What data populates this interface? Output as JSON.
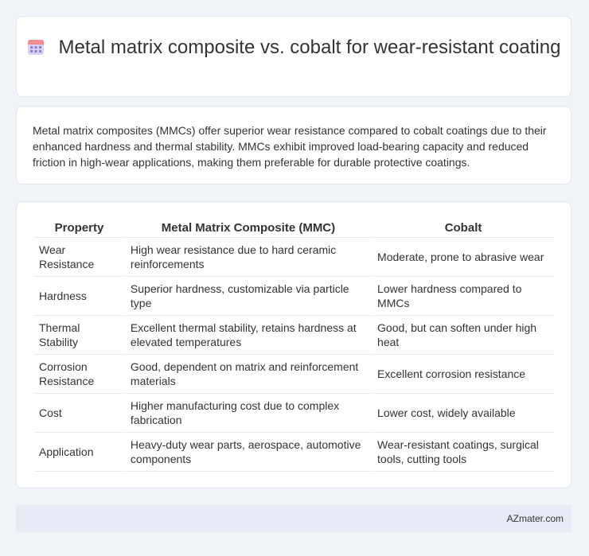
{
  "header": {
    "title": "Metal matrix composite vs. cobalt for wear-resistant coating",
    "icon": "calendar-icon"
  },
  "summary": {
    "text": "Metal matrix composites (MMCs) offer superior wear resistance compared to cobalt coatings due to their enhanced hardness and thermal stability. MMCs exhibit improved load-bearing capacity and reduced friction in high-wear applications, making them preferable for durable protective coatings."
  },
  "table": {
    "headers": [
      "Property",
      "Metal Matrix Composite (MMC)",
      "Cobalt"
    ],
    "rows": [
      [
        "Wear Resistance",
        "High wear resistance due to hard ceramic reinforcements",
        "Moderate, prone to abrasive wear"
      ],
      [
        "Hardness",
        "Superior hardness, customizable via particle type",
        "Lower hardness compared to MMCs"
      ],
      [
        "Thermal Stability",
        "Excellent thermal stability, retains hardness at elevated temperatures",
        "Good, but can soften under high heat"
      ],
      [
        "Corrosion Resistance",
        "Good, dependent on matrix and reinforcement materials",
        "Excellent corrosion resistance"
      ],
      [
        "Cost",
        "Higher manufacturing cost due to complex fabrication",
        "Lower cost, widely available"
      ],
      [
        "Application",
        "Heavy-duty wear parts, aerospace, automotive components",
        "Wear-resistant coatings, surgical tools, cutting tools"
      ]
    ]
  },
  "footer": {
    "brand": "AZmater.com"
  },
  "colors": {
    "background": "#f1f4f9",
    "card": "#ffffff",
    "footer": "#e6ebf5",
    "icon_top": "#f28b8b",
    "icon_body": "#b9a6e8"
  }
}
